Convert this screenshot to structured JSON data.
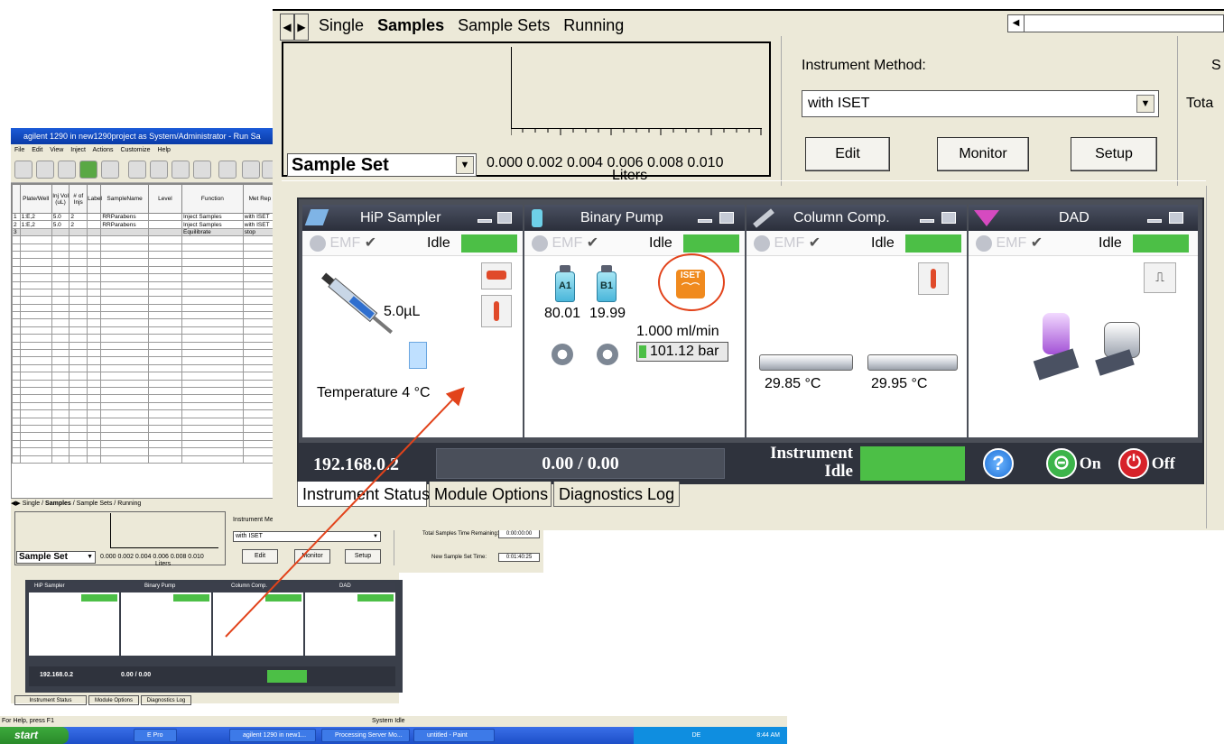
{
  "small_window": {
    "title": "agilent 1290 in new1290project as System/Administrator - Run Sa",
    "menu": [
      "File",
      "Edit",
      "View",
      "Inject",
      "Actions",
      "Customize",
      "Help"
    ],
    "columns": [
      "Plate/Well",
      "Inj Vol (uL)",
      "# of Injs",
      "Label",
      "SampleName",
      "Level",
      "Function",
      "Met Rep"
    ],
    "rows": [
      [
        "1",
        "1:E,2",
        "5.0",
        "2",
        "",
        "RRParabens",
        "",
        "Inject Samples",
        "with ISET"
      ],
      [
        "2",
        "1:E,2",
        "5.0",
        "2",
        "",
        "RRParabens",
        "",
        "Inject Samples",
        "with ISET"
      ],
      [
        "3",
        "",
        "",
        "",
        "",
        "",
        "",
        "Equilibrate",
        "stop"
      ]
    ],
    "tabs": [
      "Single",
      "Samples",
      "Sample Sets",
      "Running"
    ],
    "sample_set_label": "Sample Set",
    "axis_ticks": "0.000 0.002 0.004 0.006 0.008 0.010",
    "axis_label": "Liters",
    "instrument_method_label": "Instrument Me...",
    "instrument_method_value": "with ISET",
    "edit": "Edit",
    "monitor": "Monitor",
    "setup": "Setup",
    "total_samples_label": "Total Samples Time Remaining:",
    "total_samples_value": "0:00:00:00",
    "new_sample_set_label": "New Sample Set Time:",
    "new_sample_set_value": "0:01:40:25",
    "status_left": "For Help, press F1",
    "status_mid": "System Idle",
    "taskbar": {
      "start": "start",
      "tasks": [
        "E Pro",
        "agilent 1290 in new1...",
        "Processing Server Mo...",
        "untitled - Paint"
      ],
      "tray_time": "8:44 AM",
      "tray_lang": "DE"
    }
  },
  "big_window": {
    "tabs": [
      "Single",
      "Samples",
      "Sample Sets",
      "Running"
    ],
    "sample_set_label": "Sample Set",
    "axis_ticks": "0.000 0.002 0.004 0.006 0.008 0.010",
    "axis_label": "Liters",
    "instrument_method_label": "Instrument Method:",
    "instrument_method_value": "with ISET",
    "edit": "Edit",
    "monitor": "Monitor",
    "setup": "Setup",
    "right_cut_1": "S",
    "right_cut_2": "Tota",
    "bottom_tabs": [
      "Instrument Status",
      "Module Options",
      "Diagnostics Log"
    ]
  },
  "instrument_monitor": {
    "modules": [
      {
        "name": "HiP Sampler",
        "emf": "EMF",
        "status": "Idle",
        "volume": "5.0µL",
        "temperature": "Temperature 4 °C"
      },
      {
        "name": "Binary Pump",
        "emf": "EMF",
        "status": "Idle",
        "vial_a": "A1",
        "vial_b": "B1",
        "pct_a": "80.01",
        "pct_b": "19.99",
        "flow": "1.000 ml/min",
        "pressure": "101.12 bar",
        "iset": "ISET"
      },
      {
        "name": "Column Comp.",
        "emf": "EMF",
        "status": "Idle",
        "temp_left": "29.85 °C",
        "temp_right": "29.95 °C"
      },
      {
        "name": "DAD",
        "emf": "EMF",
        "status": "Idle"
      }
    ],
    "ip": "192.168.0.2",
    "counter": "0.00 / 0.00",
    "instrument_status_1": "Instrument",
    "instrument_status_2": "Idle",
    "help": "?",
    "on": "On",
    "off": "Off"
  },
  "colors": {
    "status_green": "#4cbf46",
    "highlight_circle": "#e2431b",
    "arrow": "#e2431b",
    "monitor_dark": "#2f333d"
  }
}
